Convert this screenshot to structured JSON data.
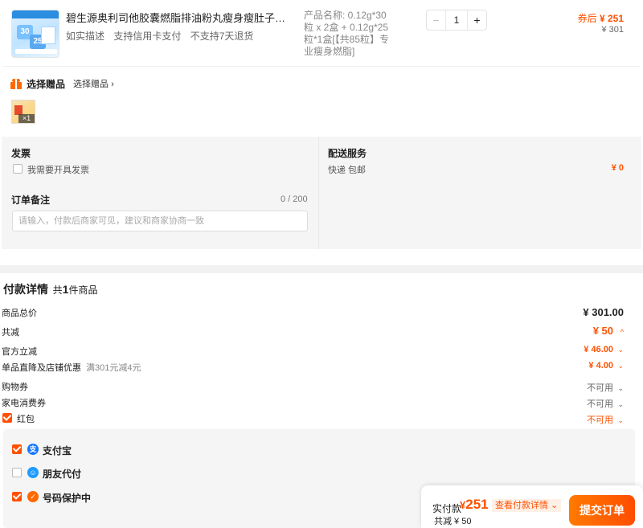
{
  "product": {
    "title": "碧生源奥利司他胶囊燃脂排油粉丸瘦身瘦肚子减肥药正...",
    "tags": [
      "如实描述",
      "支持信用卡支付",
      "不支持7天退货"
    ],
    "spec": "产品名称: 0.12g*30粒 x 2盒 + 0.12g*25粒*1盒[【共85粒】专业瘦身燃脂]",
    "quantity": "1",
    "minus": "−",
    "plus": "+",
    "after_coupon_label": "券后",
    "after_coupon_price": "¥ 251",
    "original_price": "¥ 301"
  },
  "gift": {
    "title": "选择赠品",
    "link": "选择赠品 ›",
    "count": "×1"
  },
  "invoice": {
    "title": "发票",
    "checkbox_label": "我需要开具发票"
  },
  "note": {
    "title": "订单备注",
    "count": "0 / 200",
    "placeholder": "请输入，付款后商家可见，建议和商家协商一致"
  },
  "delivery": {
    "title": "配送服务",
    "method": "快递 包邮",
    "price": "¥ 0"
  },
  "payment": {
    "title": "付款详情",
    "items_prefix": "共",
    "items_count": "1",
    "items_suffix": "件商品",
    "rows": {
      "total_label": "商品总价",
      "total_value": "¥ 301.00",
      "discount_label": "共减",
      "discount_value": "¥ 50",
      "official_label": "官方立减",
      "official_value": "¥ 46.00",
      "store_label": "单品直降及店铺优惠",
      "store_hint": "满301元减4元",
      "store_value": "¥ 4.00",
      "voucher_label": "购物券",
      "voucher_value": "不可用",
      "appliance_label": "家电消费券",
      "appliance_value": "不可用",
      "redpacket_label": "红包",
      "redpacket_value": "不可用"
    },
    "methods": {
      "alipay": "支付宝",
      "friend": "朋友代付",
      "protect": "号码保护中"
    }
  },
  "footer": {
    "paid_label": "实付款",
    "currency": "¥",
    "paid_amount": "251",
    "detail_link": "查看付款详情 ⌄",
    "saved": "共减 ¥ 50",
    "submit": "提交订单"
  },
  "colors": {
    "accent": "#ff5000",
    "alipay_blue": "#1677ff",
    "protect_orange": "#ff6a00"
  }
}
